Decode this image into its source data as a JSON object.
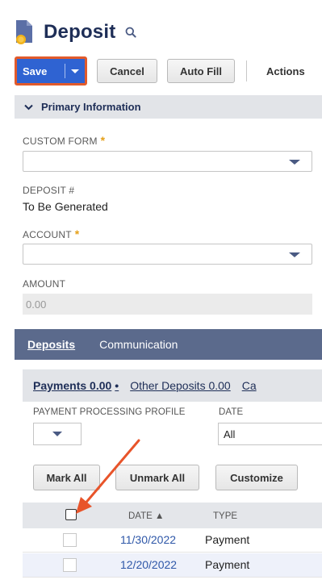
{
  "header": {
    "title": "Deposit",
    "icon": "deposit-doc-icon",
    "search_icon": "search-icon"
  },
  "toolbar": {
    "save_label": "Save",
    "cancel_label": "Cancel",
    "autofill_label": "Auto Fill",
    "actions_label": "Actions"
  },
  "primary": {
    "section_title": "Primary Information",
    "custom_form_label": "CUSTOM FORM",
    "deposit_no_label": "DEPOSIT #",
    "deposit_no_value": "To Be Generated",
    "account_label": "ACCOUNT",
    "amount_label": "AMOUNT",
    "amount_value": "0.00",
    "required_mark": "*"
  },
  "subtabs": {
    "deposits": "Deposits",
    "communication": "Communication"
  },
  "inner_tabs": {
    "payments": "Payments 0.00",
    "payments_dot": "•",
    "other_deposits": "Other Deposits 0.00",
    "truncated": "Ca"
  },
  "filters": {
    "profile_label": "PAYMENT PROCESSING PROFILE",
    "date_label": "DATE",
    "date_value": "All"
  },
  "list_buttons": {
    "mark_all": "Mark All",
    "unmark_all": "Unmark All",
    "customize": "Customize"
  },
  "table": {
    "columns": [
      "DATE ▲",
      "TYPE"
    ],
    "rows": [
      {
        "date": "11/30/2022",
        "type": "Payment"
      },
      {
        "date": "12/20/2022",
        "type": "Payment"
      }
    ]
  },
  "colors": {
    "save_bg": "#2f63d2",
    "highlight": "#e25a2b",
    "subtab_bar": "#5b6a8c",
    "title_color": "#1e2e57"
  }
}
